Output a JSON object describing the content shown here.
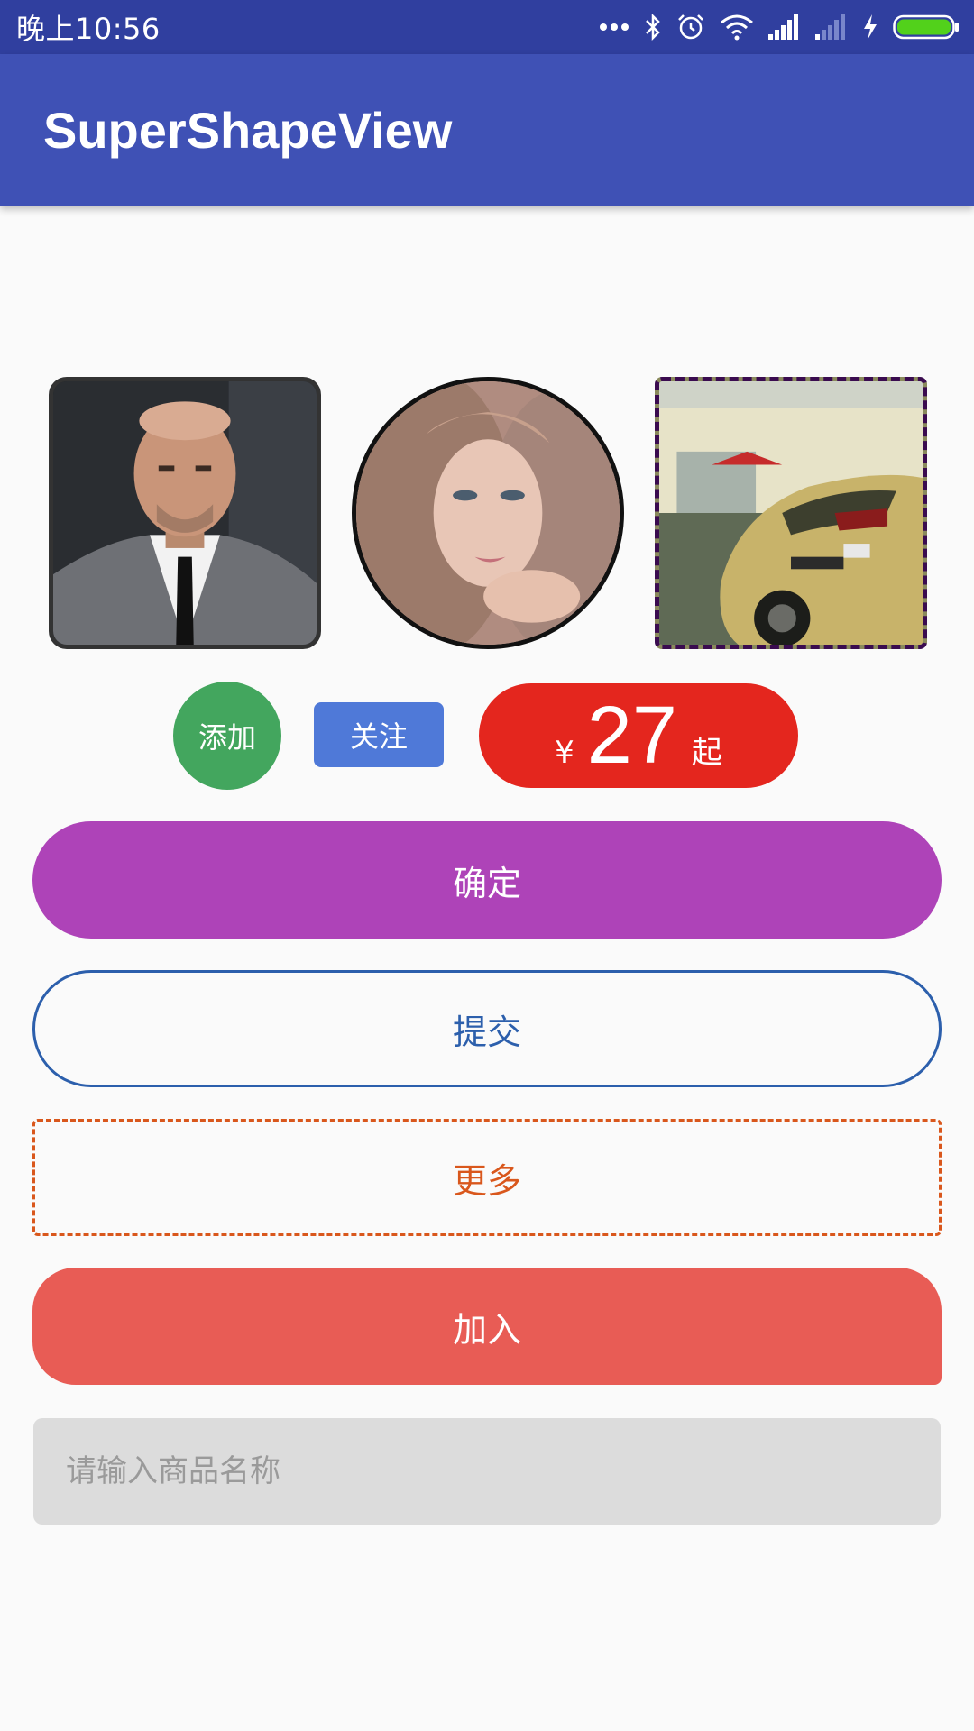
{
  "status_bar": {
    "time": "晚上10:56",
    "icons": [
      "more-dots-icon",
      "bluetooth-icon",
      "alarm-icon",
      "wifi-icon",
      "signal-icon",
      "signal-weak-icon",
      "charging-icon",
      "battery-icon"
    ]
  },
  "app_bar": {
    "title": "SuperShapeView"
  },
  "images": [
    {
      "name": "portrait-man-image",
      "shape": "rounded-square"
    },
    {
      "name": "portrait-woman-image",
      "shape": "circle"
    },
    {
      "name": "sports-car-image",
      "shape": "dashed-square"
    }
  ],
  "controls": {
    "add_label": "添加",
    "follow_label": "关注",
    "price": {
      "currency": "¥",
      "value": "27",
      "suffix": "起"
    }
  },
  "buttons": {
    "confirm_label": "确定",
    "submit_label": "提交",
    "more_label": "更多",
    "join_label": "加入"
  },
  "search": {
    "placeholder": "请输入商品名称",
    "value": ""
  },
  "colors": {
    "status_bar": "#303f9f",
    "app_bar": "#3f51b5",
    "add_button": "#43a65e",
    "follow_button": "#4f79d8",
    "price_badge": "#e4261e",
    "confirm_button": "#ae43b8",
    "submit_border": "#2c5fac",
    "more_border": "#d9571c",
    "join_button": "#e85c55",
    "input_background": "#dcdcdc"
  }
}
